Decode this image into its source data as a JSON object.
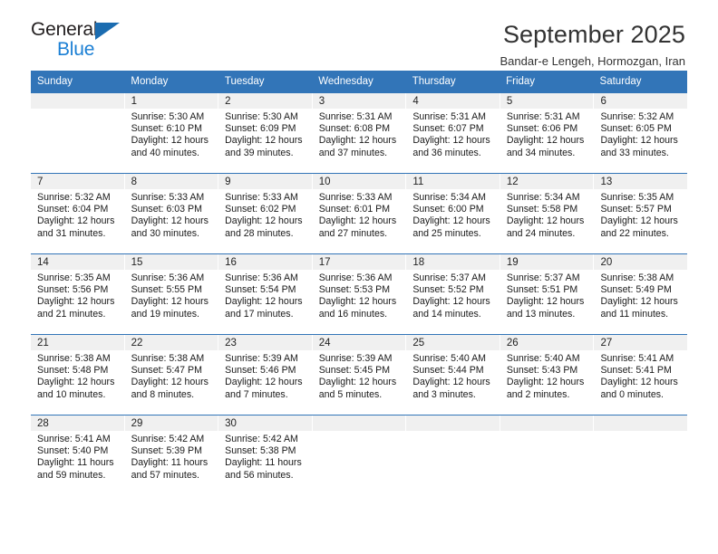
{
  "brand": {
    "name_part1": "General",
    "name_part2": "Blue",
    "triangle_color": "#1b6cb0",
    "blue_color": "#1b7fd4"
  },
  "header": {
    "title": "September 2025",
    "location": "Bandar-e Lengeh, Hormozgan, Iran",
    "header_bg": "#3275b8",
    "daynum_bg": "#f0f0f0"
  },
  "calendar": {
    "weekdays": [
      "Sunday",
      "Monday",
      "Tuesday",
      "Wednesday",
      "Thursday",
      "Friday",
      "Saturday"
    ],
    "labels": {
      "sunrise": "Sunrise:",
      "sunset": "Sunset:",
      "daylight": "Daylight:"
    },
    "weeks": [
      [
        {
          "day": ""
        },
        {
          "day": "1",
          "sunrise": "Sunrise: 5:30 AM",
          "sunset": "Sunset: 6:10 PM",
          "daylight_1": "Daylight: 12 hours",
          "daylight_2": "and 40 minutes."
        },
        {
          "day": "2",
          "sunrise": "Sunrise: 5:30 AM",
          "sunset": "Sunset: 6:09 PM",
          "daylight_1": "Daylight: 12 hours",
          "daylight_2": "and 39 minutes."
        },
        {
          "day": "3",
          "sunrise": "Sunrise: 5:31 AM",
          "sunset": "Sunset: 6:08 PM",
          "daylight_1": "Daylight: 12 hours",
          "daylight_2": "and 37 minutes."
        },
        {
          "day": "4",
          "sunrise": "Sunrise: 5:31 AM",
          "sunset": "Sunset: 6:07 PM",
          "daylight_1": "Daylight: 12 hours",
          "daylight_2": "and 36 minutes."
        },
        {
          "day": "5",
          "sunrise": "Sunrise: 5:31 AM",
          "sunset": "Sunset: 6:06 PM",
          "daylight_1": "Daylight: 12 hours",
          "daylight_2": "and 34 minutes."
        },
        {
          "day": "6",
          "sunrise": "Sunrise: 5:32 AM",
          "sunset": "Sunset: 6:05 PM",
          "daylight_1": "Daylight: 12 hours",
          "daylight_2": "and 33 minutes."
        }
      ],
      [
        {
          "day": "7",
          "sunrise": "Sunrise: 5:32 AM",
          "sunset": "Sunset: 6:04 PM",
          "daylight_1": "Daylight: 12 hours",
          "daylight_2": "and 31 minutes."
        },
        {
          "day": "8",
          "sunrise": "Sunrise: 5:33 AM",
          "sunset": "Sunset: 6:03 PM",
          "daylight_1": "Daylight: 12 hours",
          "daylight_2": "and 30 minutes."
        },
        {
          "day": "9",
          "sunrise": "Sunrise: 5:33 AM",
          "sunset": "Sunset: 6:02 PM",
          "daylight_1": "Daylight: 12 hours",
          "daylight_2": "and 28 minutes."
        },
        {
          "day": "10",
          "sunrise": "Sunrise: 5:33 AM",
          "sunset": "Sunset: 6:01 PM",
          "daylight_1": "Daylight: 12 hours",
          "daylight_2": "and 27 minutes."
        },
        {
          "day": "11",
          "sunrise": "Sunrise: 5:34 AM",
          "sunset": "Sunset: 6:00 PM",
          "daylight_1": "Daylight: 12 hours",
          "daylight_2": "and 25 minutes."
        },
        {
          "day": "12",
          "sunrise": "Sunrise: 5:34 AM",
          "sunset": "Sunset: 5:58 PM",
          "daylight_1": "Daylight: 12 hours",
          "daylight_2": "and 24 minutes."
        },
        {
          "day": "13",
          "sunrise": "Sunrise: 5:35 AM",
          "sunset": "Sunset: 5:57 PM",
          "daylight_1": "Daylight: 12 hours",
          "daylight_2": "and 22 minutes."
        }
      ],
      [
        {
          "day": "14",
          "sunrise": "Sunrise: 5:35 AM",
          "sunset": "Sunset: 5:56 PM",
          "daylight_1": "Daylight: 12 hours",
          "daylight_2": "and 21 minutes."
        },
        {
          "day": "15",
          "sunrise": "Sunrise: 5:36 AM",
          "sunset": "Sunset: 5:55 PM",
          "daylight_1": "Daylight: 12 hours",
          "daylight_2": "and 19 minutes."
        },
        {
          "day": "16",
          "sunrise": "Sunrise: 5:36 AM",
          "sunset": "Sunset: 5:54 PM",
          "daylight_1": "Daylight: 12 hours",
          "daylight_2": "and 17 minutes."
        },
        {
          "day": "17",
          "sunrise": "Sunrise: 5:36 AM",
          "sunset": "Sunset: 5:53 PM",
          "daylight_1": "Daylight: 12 hours",
          "daylight_2": "and 16 minutes."
        },
        {
          "day": "18",
          "sunrise": "Sunrise: 5:37 AM",
          "sunset": "Sunset: 5:52 PM",
          "daylight_1": "Daylight: 12 hours",
          "daylight_2": "and 14 minutes."
        },
        {
          "day": "19",
          "sunrise": "Sunrise: 5:37 AM",
          "sunset": "Sunset: 5:51 PM",
          "daylight_1": "Daylight: 12 hours",
          "daylight_2": "and 13 minutes."
        },
        {
          "day": "20",
          "sunrise": "Sunrise: 5:38 AM",
          "sunset": "Sunset: 5:49 PM",
          "daylight_1": "Daylight: 12 hours",
          "daylight_2": "and 11 minutes."
        }
      ],
      [
        {
          "day": "21",
          "sunrise": "Sunrise: 5:38 AM",
          "sunset": "Sunset: 5:48 PM",
          "daylight_1": "Daylight: 12 hours",
          "daylight_2": "and 10 minutes."
        },
        {
          "day": "22",
          "sunrise": "Sunrise: 5:38 AM",
          "sunset": "Sunset: 5:47 PM",
          "daylight_1": "Daylight: 12 hours",
          "daylight_2": "and 8 minutes."
        },
        {
          "day": "23",
          "sunrise": "Sunrise: 5:39 AM",
          "sunset": "Sunset: 5:46 PM",
          "daylight_1": "Daylight: 12 hours",
          "daylight_2": "and 7 minutes."
        },
        {
          "day": "24",
          "sunrise": "Sunrise: 5:39 AM",
          "sunset": "Sunset: 5:45 PM",
          "daylight_1": "Daylight: 12 hours",
          "daylight_2": "and 5 minutes."
        },
        {
          "day": "25",
          "sunrise": "Sunrise: 5:40 AM",
          "sunset": "Sunset: 5:44 PM",
          "daylight_1": "Daylight: 12 hours",
          "daylight_2": "and 3 minutes."
        },
        {
          "day": "26",
          "sunrise": "Sunrise: 5:40 AM",
          "sunset": "Sunset: 5:43 PM",
          "daylight_1": "Daylight: 12 hours",
          "daylight_2": "and 2 minutes."
        },
        {
          "day": "27",
          "sunrise": "Sunrise: 5:41 AM",
          "sunset": "Sunset: 5:41 PM",
          "daylight_1": "Daylight: 12 hours",
          "daylight_2": "and 0 minutes."
        }
      ],
      [
        {
          "day": "28",
          "sunrise": "Sunrise: 5:41 AM",
          "sunset": "Sunset: 5:40 PM",
          "daylight_1": "Daylight: 11 hours",
          "daylight_2": "and 59 minutes."
        },
        {
          "day": "29",
          "sunrise": "Sunrise: 5:42 AM",
          "sunset": "Sunset: 5:39 PM",
          "daylight_1": "Daylight: 11 hours",
          "daylight_2": "and 57 minutes."
        },
        {
          "day": "30",
          "sunrise": "Sunrise: 5:42 AM",
          "sunset": "Sunset: 5:38 PM",
          "daylight_1": "Daylight: 11 hours",
          "daylight_2": "and 56 minutes."
        },
        {
          "day": ""
        },
        {
          "day": ""
        },
        {
          "day": ""
        },
        {
          "day": ""
        }
      ]
    ]
  }
}
